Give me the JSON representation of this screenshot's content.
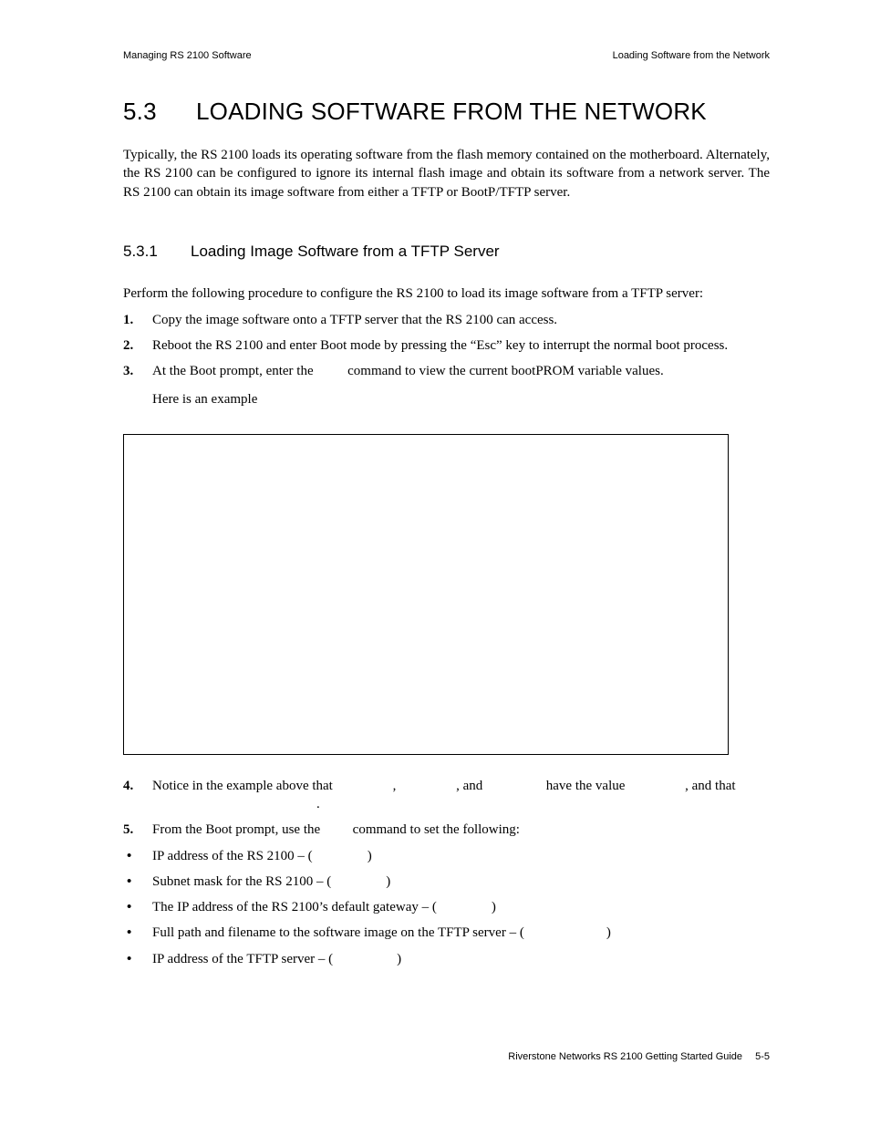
{
  "header": {
    "left": "Managing RS 2100 Software",
    "right": "Loading Software from the Network"
  },
  "h1": {
    "num": "5.3",
    "text": "LOADING SOFTWARE FROM THE NETWORK"
  },
  "intro": "Typically, the RS 2100 loads its operating software from the flash memory contained on the motherboard. Alternately, the RS 2100 can be configured to ignore its internal flash image and obtain its software from a network server. The RS 2100 can obtain its image software from either a TFTP or BootP/TFTP server.",
  "h2": {
    "num": "5.3.1",
    "text": "Loading Image Software from a TFTP Server"
  },
  "lead": "Perform the following procedure to configure the RS 2100 to load its image software from a TFTP server:",
  "ol": {
    "i1": {
      "num": "1.",
      "text": "Copy the image software onto a TFTP server that the RS 2100 can access."
    },
    "i2": {
      "num": "2.",
      "text": "Reboot the RS 2100 and enter Boot mode by pressing the “Esc” key to interrupt the normal boot process."
    },
    "i3": {
      "num": "3.",
      "t1": "At the Boot prompt, enter the ",
      "t2": " command to view the current bootPROM variable values.",
      "sub": "Here is an example"
    },
    "i4": {
      "num": "4.",
      "t1": "Notice in the example above that ",
      "t2": ", ",
      "t3": ", and ",
      "t4": " have the value ",
      "t5": ", and that ",
      "t6": "."
    },
    "i5": {
      "num": "5.",
      "t1": "From the Boot prompt, use the ",
      "t2": " command to set the following:"
    }
  },
  "bullets": {
    "b1": {
      "t1": "IP address of the RS 2100 – (",
      "t2": ")"
    },
    "b2": {
      "t1": "Subnet mask for the RS 2100 – (",
      "t2": ")"
    },
    "b3": {
      "t1": "The IP address of the RS 2100’s default gateway – (",
      "t2": ")"
    },
    "b4": {
      "t1": "Full path and filename to the software image on the TFTP server – (",
      "t2": ")"
    },
    "b5": {
      "t1": "IP address of the TFTP server – (",
      "t2": ")"
    }
  },
  "footer": {
    "text": "Riverstone Networks RS 2100 Getting Started Guide  5-5"
  }
}
